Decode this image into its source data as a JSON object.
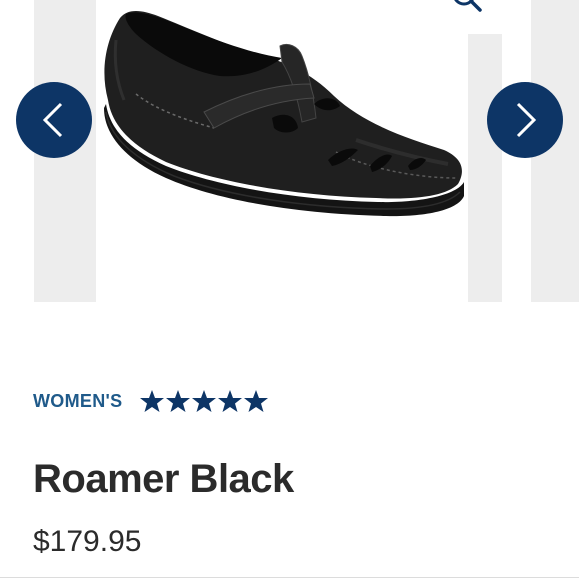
{
  "gallery": {
    "image_alt": "Roamer Black shoe",
    "icons": {
      "prev": "chevron-left-icon",
      "next": "chevron-right-icon",
      "zoom": "magnifier-icon"
    },
    "accent_color": "#0d3566"
  },
  "product": {
    "category": "WOMEN'S",
    "rating": 5,
    "rating_max": 5,
    "name": "Roamer Black",
    "price": "$179.95"
  }
}
